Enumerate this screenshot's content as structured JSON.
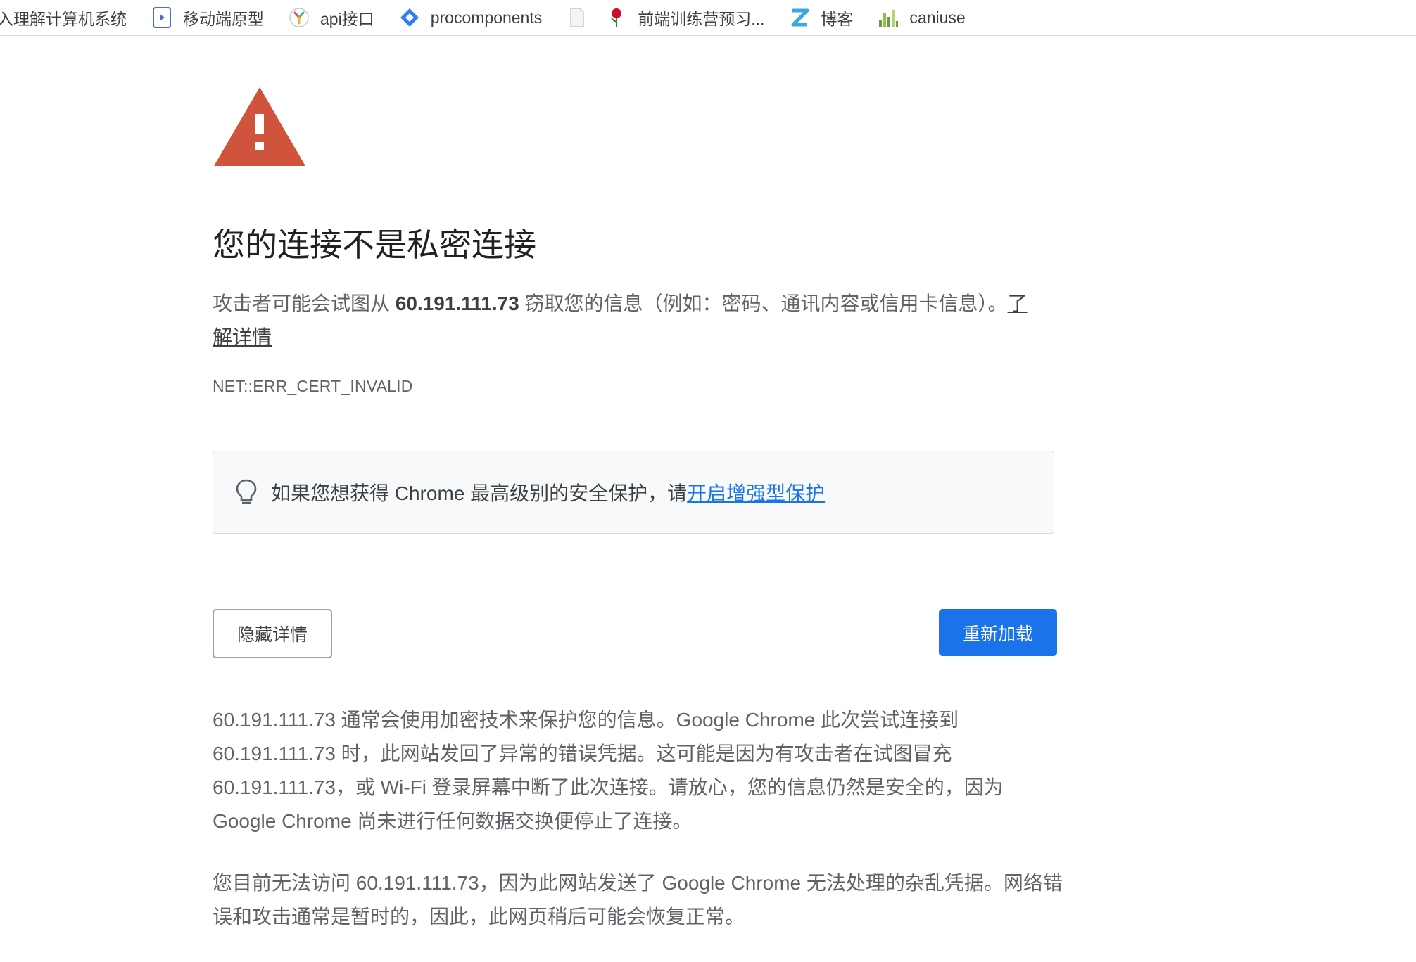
{
  "bookmarks": [
    {
      "icon": "book-icon",
      "label": "入理解计算机系统"
    },
    {
      "icon": "play-doc-icon",
      "label": "移动端原型"
    },
    {
      "icon": "api-logo-icon",
      "label": "api接口"
    },
    {
      "icon": "diamond-logo-icon",
      "label": "procomponents"
    },
    {
      "icon": "blank-page-icon",
      "label": ""
    },
    {
      "icon": "rose-icon",
      "label": "前端训练营预习..."
    },
    {
      "icon": "z-logo-icon",
      "label": "博客"
    },
    {
      "icon": "bar-chart-logo-icon",
      "label": "caniuse"
    }
  ],
  "page": {
    "title": "您的连接不是私密连接",
    "intro_before": "攻击者可能会试图从 ",
    "intro_host": "60.191.111.73",
    "intro_after": " 窃取您的信息（例如：密码、通讯内容或信用卡信息）。",
    "learn_more": "了解详情",
    "error_code": "NET::ERR_CERT_INVALID",
    "tip_text": "如果您想获得 Chrome 最高级别的安全保护，请",
    "tip_link": "开启增强型保护",
    "hide_details_label": "隐藏详情",
    "reload_label": "重新加载",
    "details_p1": "60.191.111.73 通常会使用加密技术来保护您的信息。Google Chrome 此次尝试连接到 60.191.111.73 时，此网站发回了异常的错误凭据。这可能是因为有攻击者在试图冒充 60.191.111.73，或 Wi-Fi 登录屏幕中断了此次连接。请放心，您的信息仍然是安全的，因为 Google Chrome 尚未进行任何数据交换便停止了连接。",
    "details_p2": "您目前无法访问 60.191.111.73，因为此网站发送了 Google Chrome 无法处理的杂乱凭据。网络错误和攻击通常是暂时的，因此，此网页稍后可能会恢复正常。"
  },
  "colors": {
    "warning_red": "#d0543b",
    "link_blue": "#1a73e8",
    "button_blue": "#1a73e8"
  }
}
